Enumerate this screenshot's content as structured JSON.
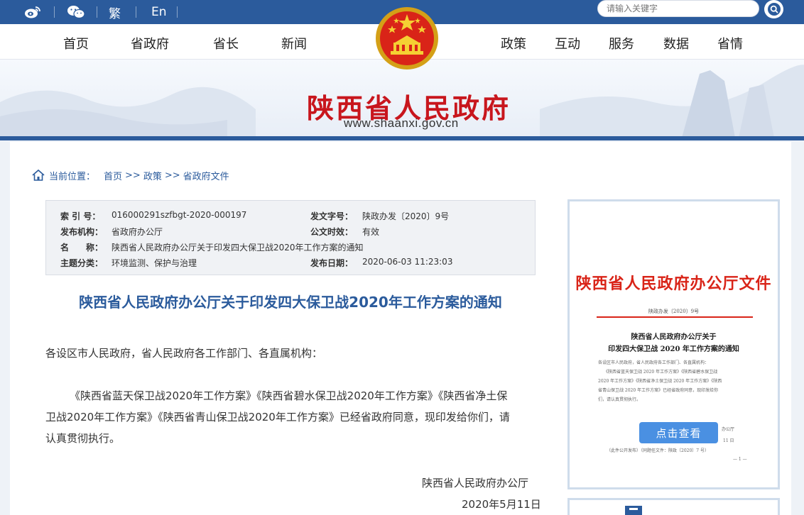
{
  "topbar": {
    "weibo_icon": "weibo-icon",
    "wechat_icon": "wechat-icon",
    "traditional_label": "繁",
    "english_label": "En",
    "search": {
      "placeholder": "请输入关键字",
      "icon": "search-icon"
    }
  },
  "nav": {
    "left": [
      "首页",
      "省政府",
      "省长",
      "新闻"
    ],
    "right": [
      "政策",
      "互动",
      "服务",
      "数据",
      "省情"
    ]
  },
  "banner": {
    "title": "陕西省人民政府",
    "url": "www.shaanxi.gov.cn",
    "emblem": "national-emblem"
  },
  "breadcrumb": {
    "home_icon": "home-icon",
    "label": "当前位置：",
    "items": [
      "首页",
      ">>",
      "政策",
      ">>",
      "省政府文件"
    ]
  },
  "info": {
    "index_label": "索 引 号：",
    "index_value": "016000291szfbgt-2020-000197",
    "docno_label": "发文字号：",
    "docno_value": "陕政办发〔2020〕9号",
    "org_label": "发布机构：",
    "org_value": "省政府办公厅",
    "valid_label": "公文时效：",
    "valid_value": "有效",
    "name_label": "名　　称：",
    "name_value": "陕西省人民政府办公厅关于印发四大保卫战2020年工作方案的通知",
    "topic_label": "主题分类：",
    "topic_value": "环境监测、保护与治理",
    "date_label": "发布日期：",
    "date_value": "2020-06-03 11:23:03"
  },
  "doc": {
    "title": "陕西省人民政府办公厅关于印发四大保卫战2020年工作方案的通知",
    "greeting": "各设区市人民政府，省人民政府各工作部门、各直属机构：",
    "body_lines": [
      "《陕西省蓝天保卫战2020年工作方案》《陕西省碧水保卫战2020年工作方案》《陕西省净土保",
      "卫战2020年工作方案》《陕西省青山保卫战2020年工作方案》已经省政府同意，现印发给你们，请",
      "认真贯彻执行。"
    ],
    "signer": "陕西省人民政府办公厅",
    "sign_date": "2020年5月11日"
  },
  "preview": {
    "header": "陕西省人民政府办公厅文件",
    "number": "陕政办发〔2020〕9号",
    "title_line1": "陕西省人民政府办公厅关于",
    "title_line2": "印发四大保卫战 2020 年工作方案的通知",
    "body_lines": [
      "各设区市人民政府，省人民政府各工作部门、各直属机构：",
      "《陕西省蓝天保卫战 2020 年工作方案》《陕西省碧水保卫战",
      "2020 年工作方案》《陕西省净土保卫战 2020 年工作方案》《陕西",
      "省青山保卫战 2020 年工作方案》已经省政府同意，现印发给你",
      "们，请认真贯彻执行。"
    ],
    "office_tail": "办公厅",
    "day_tail": "11 日",
    "note": "（此件公开发布）（同题任文件：陕政〔2020〕7 号）",
    "page_no": "— 1 —",
    "button_label": "点击查看"
  }
}
